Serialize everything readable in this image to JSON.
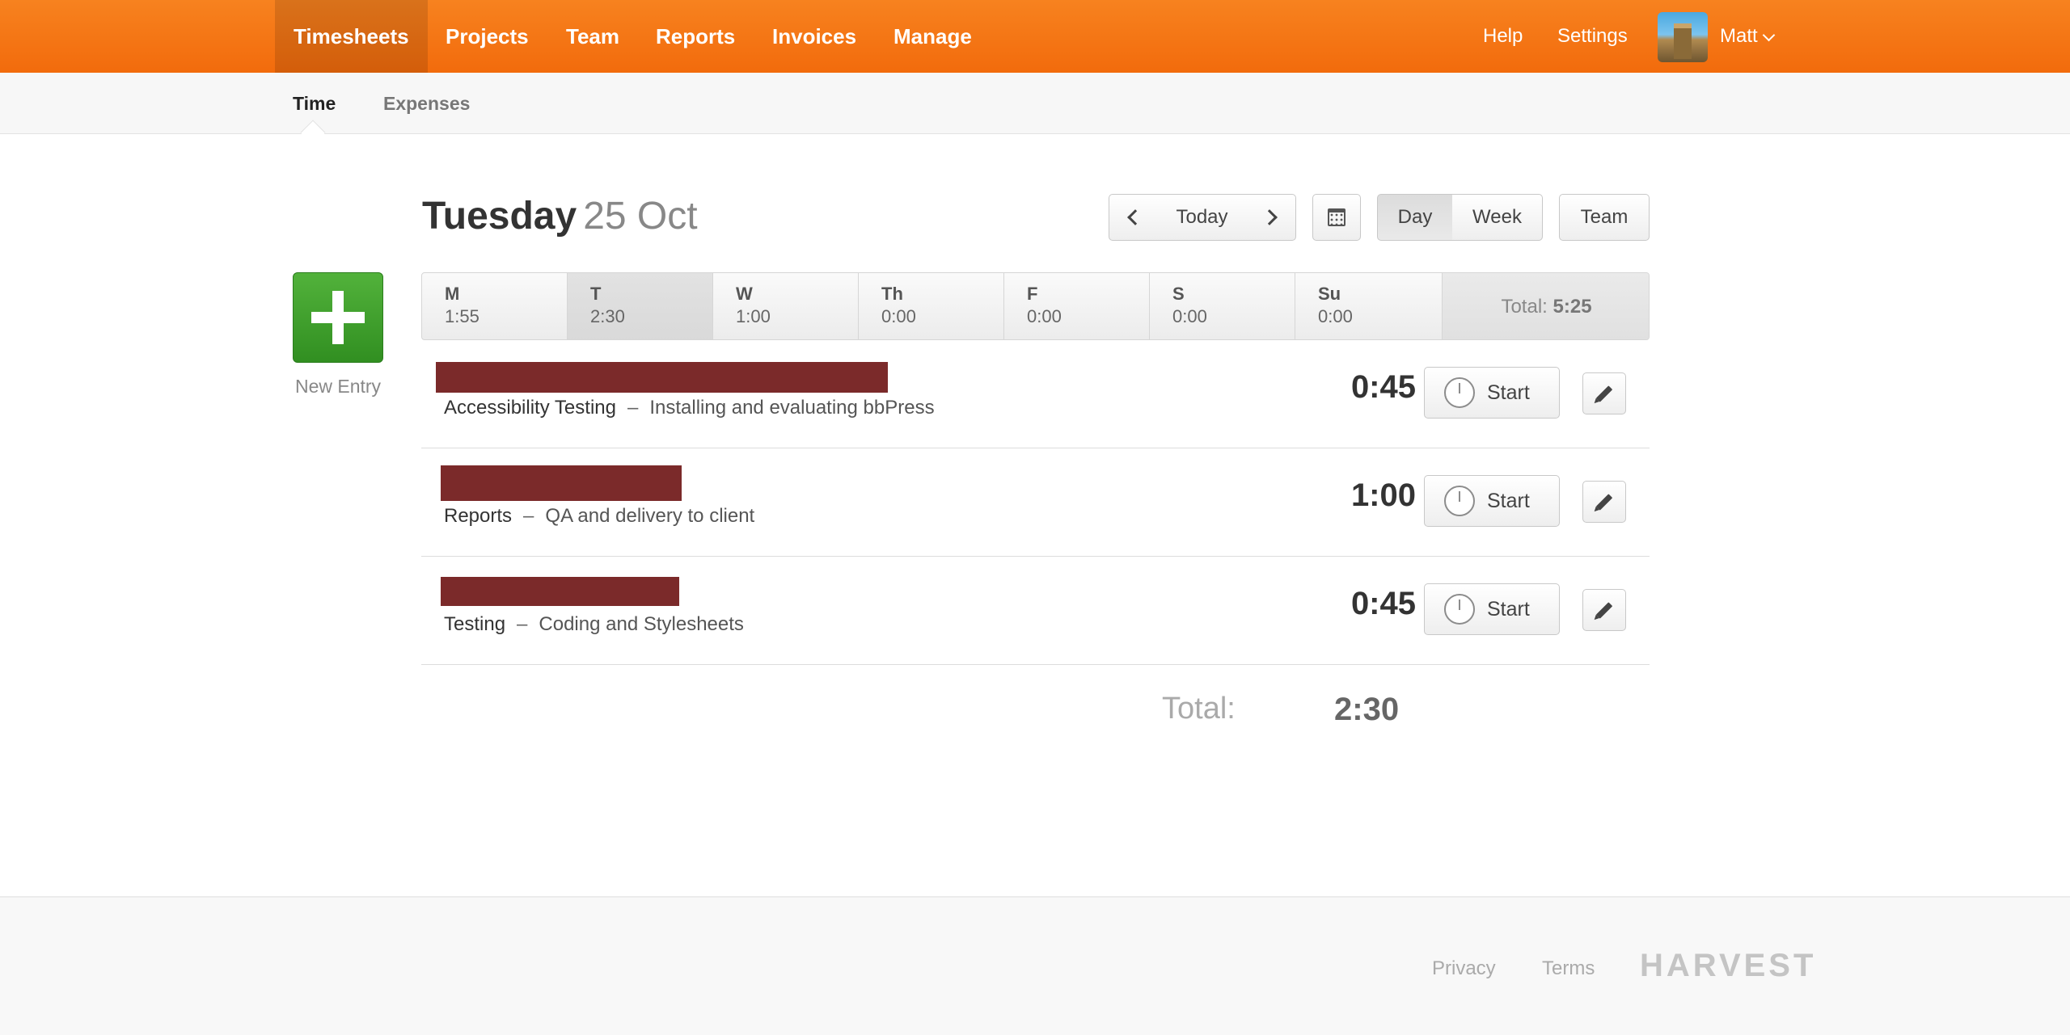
{
  "topnav": {
    "items": [
      "Timesheets",
      "Projects",
      "Team",
      "Reports",
      "Invoices",
      "Manage"
    ],
    "active": "Timesheets",
    "help": "Help",
    "settings": "Settings",
    "user": "Matt",
    "brand_color": "#f26b0c"
  },
  "subnav": {
    "time": "Time",
    "expenses": "Expenses"
  },
  "header": {
    "weekday": "Tuesday",
    "date": "25 Oct",
    "today": "Today",
    "day": "Day",
    "week": "Week",
    "team": "Team"
  },
  "week": {
    "days": [
      {
        "abbr": "M",
        "hours": "1:55"
      },
      {
        "abbr": "T",
        "hours": "2:30"
      },
      {
        "abbr": "W",
        "hours": "1:00"
      },
      {
        "abbr": "Th",
        "hours": "0:00"
      },
      {
        "abbr": "F",
        "hours": "0:00"
      },
      {
        "abbr": "S",
        "hours": "0:00"
      },
      {
        "abbr": "Su",
        "hours": "0:00"
      }
    ],
    "total_label": "Total:",
    "total_value": "5:25"
  },
  "new_entry": {
    "label": "New Entry",
    "color": "#3fa22c"
  },
  "entries": [
    {
      "task": "Accessibility Testing",
      "sep": "–",
      "note": "Installing and evaluating bbPress",
      "time": "0:45",
      "start": "Start"
    },
    {
      "task": "Reports",
      "sep": "–",
      "note": "QA and delivery to client",
      "time": "1:00",
      "start": "Start"
    },
    {
      "task": "Testing",
      "sep": "–",
      "note": "Coding and Stylesheets",
      "time": "0:45",
      "start": "Start"
    }
  ],
  "redaction_color": "#7b2a2a",
  "total": {
    "label": "Total:",
    "value": "2:30"
  },
  "footer": {
    "privacy": "Privacy",
    "terms": "Terms",
    "logo": "HARVEST"
  }
}
